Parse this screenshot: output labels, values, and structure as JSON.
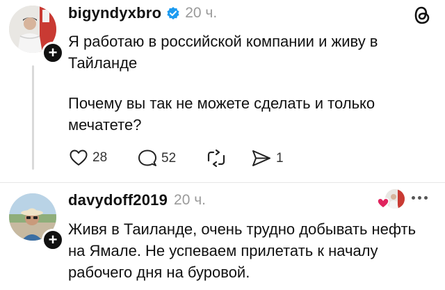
{
  "post1": {
    "username": "bigyndyxbro",
    "time": "20 ч.",
    "paragraph1": "Я работаю в российской компании и живу в Тайланде",
    "paragraph2": "Почему вы так не можете сделать и только мечатете?",
    "likes": "28",
    "comments": "52",
    "shares": "1"
  },
  "post2": {
    "username": "davydoff2019",
    "time": "20 ч.",
    "text": "Живя в Таиланде, очень трудно добывать нефть на Ямале. Не успеваем прилетать к началу рабочего дня на буровой."
  },
  "icons": {
    "verified": "verified-badge-icon",
    "app_logo": "threads-logo-icon",
    "like": "heart-icon",
    "comment": "comment-bubble-icon",
    "repost": "repost-icon",
    "share": "send-icon",
    "more": "more-dots-icon"
  },
  "colors": {
    "verified": "#1d9bf0",
    "text": "#111111",
    "muted": "#9a9a9a",
    "reaction_heart": "#e0245e"
  }
}
